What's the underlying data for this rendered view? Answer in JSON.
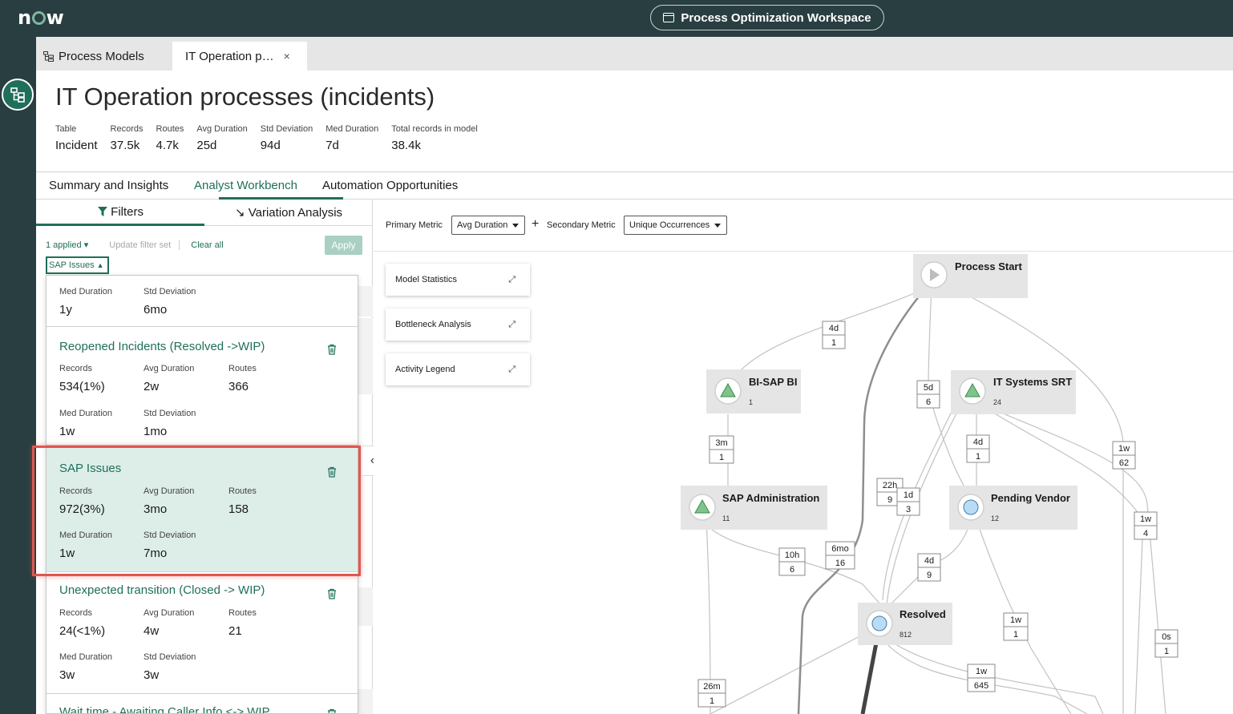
{
  "brand": {
    "logo_text_left": "n",
    "logo_text_right": "w"
  },
  "topbar": {
    "workspace_title": "Process Optimization Workspace"
  },
  "tabs": {
    "process_models": "Process Models",
    "current": "IT Operation p…",
    "close": "×"
  },
  "page": {
    "title": "IT Operation processes (incidents)",
    "stats": [
      {
        "label": "Table",
        "value": "Incident"
      },
      {
        "label": "Records",
        "value": "37.5k"
      },
      {
        "label": "Routes",
        "value": "4.7k"
      },
      {
        "label": "Avg Duration",
        "value": "25d"
      },
      {
        "label": "Std Deviation",
        "value": "94d"
      },
      {
        "label": "Med Duration",
        "value": "7d"
      },
      {
        "label": "Total records in model",
        "value": "38.4k"
      }
    ]
  },
  "main_tabs": [
    {
      "label": "Summary and Insights",
      "active": false
    },
    {
      "label": "Analyst Workbench",
      "active": true
    },
    {
      "label": "Automation Opportunities",
      "active": false
    }
  ],
  "left_panel": {
    "subtabs": {
      "filters": "Filters",
      "variation": "Variation Analysis"
    },
    "applied": "1 applied",
    "update_filter_set": "Update filter set",
    "clear_all": "Clear all",
    "apply": "Apply",
    "chip": "SAP Issues",
    "dropdown": {
      "partial_card": {
        "med_label": "Med Duration",
        "med_value": "1y",
        "std_label": "Std Deviation",
        "std_value": "6mo"
      },
      "cards": [
        {
          "title": "Reopened Incidents (Resolved ->WIP)",
          "records_label": "Records",
          "records": "534(1%)",
          "avg_label": "Avg Duration",
          "avg": "2w",
          "routes_label": "Routes",
          "routes": "366",
          "med_label": "Med Duration",
          "med": "1w",
          "std_label": "Std Deviation",
          "std": "1mo"
        },
        {
          "title": "SAP Issues",
          "records_label": "Records",
          "records": "972(3%)",
          "avg_label": "Avg Duration",
          "avg": "3mo",
          "routes_label": "Routes",
          "routes": "158",
          "med_label": "Med Duration",
          "med": "1w",
          "std_label": "Std Deviation",
          "std": "7mo"
        },
        {
          "title": "Unexpected transition (Closed -> WIP)",
          "records_label": "Records",
          "records": "24(<1%)",
          "avg_label": "Avg Duration",
          "avg": "4w",
          "routes_label": "Routes",
          "routes": "21",
          "med_label": "Med Duration",
          "med": "3w",
          "std_label": "Std Deviation",
          "std": "3w"
        }
      ],
      "cut_off_title": "Wait time - Awaiting Caller Info <-> WIP"
    }
  },
  "metric_bar": {
    "primary_label": "Primary Metric",
    "primary_value": "Avg Duration",
    "plus": "+",
    "secondary_label": "Secondary Metric",
    "secondary_value": "Unique Occurrences"
  },
  "side_cards": [
    "Model Statistics",
    "Bottleneck Analysis",
    "Activity Legend"
  ],
  "graph": {
    "nodes": [
      {
        "id": "process-start",
        "title": "Process Start",
        "count": ""
      },
      {
        "id": "bi-sap-bi",
        "title": "BI-SAP BI",
        "count": "1"
      },
      {
        "id": "it-systems-srt",
        "title": "IT Systems SRT",
        "count": "24"
      },
      {
        "id": "sap-administration",
        "title": "SAP Administration",
        "count": "11"
      },
      {
        "id": "pending-vendor",
        "title": "Pending Vendor",
        "count": "12"
      },
      {
        "id": "resolved",
        "title": "Resolved",
        "count": "812"
      }
    ],
    "edge_labels": [
      {
        "duration": "4d",
        "count": "1"
      },
      {
        "duration": "5d",
        "count": "6"
      },
      {
        "duration": "1w",
        "count": "62"
      },
      {
        "duration": "3m",
        "count": "1"
      },
      {
        "duration": "4d",
        "count": "1"
      },
      {
        "duration": "22h",
        "count": "9"
      },
      {
        "duration": "1d",
        "count": "3"
      },
      {
        "duration": "1w",
        "count": "4"
      },
      {
        "duration": "10h",
        "count": "6"
      },
      {
        "duration": "6mo",
        "count": "16"
      },
      {
        "duration": "4d",
        "count": "9"
      },
      {
        "duration": "1w",
        "count": "1"
      },
      {
        "duration": "0s",
        "count": "1"
      },
      {
        "duration": "1w",
        "count": "645"
      },
      {
        "duration": "26m",
        "count": "1"
      }
    ]
  },
  "colors": {
    "topbar": "#293e40",
    "accent": "#1f6f5a",
    "highlight": "#e0574f",
    "node_triangle": "#7fc48a",
    "node_circle": "#b9dcf5"
  }
}
